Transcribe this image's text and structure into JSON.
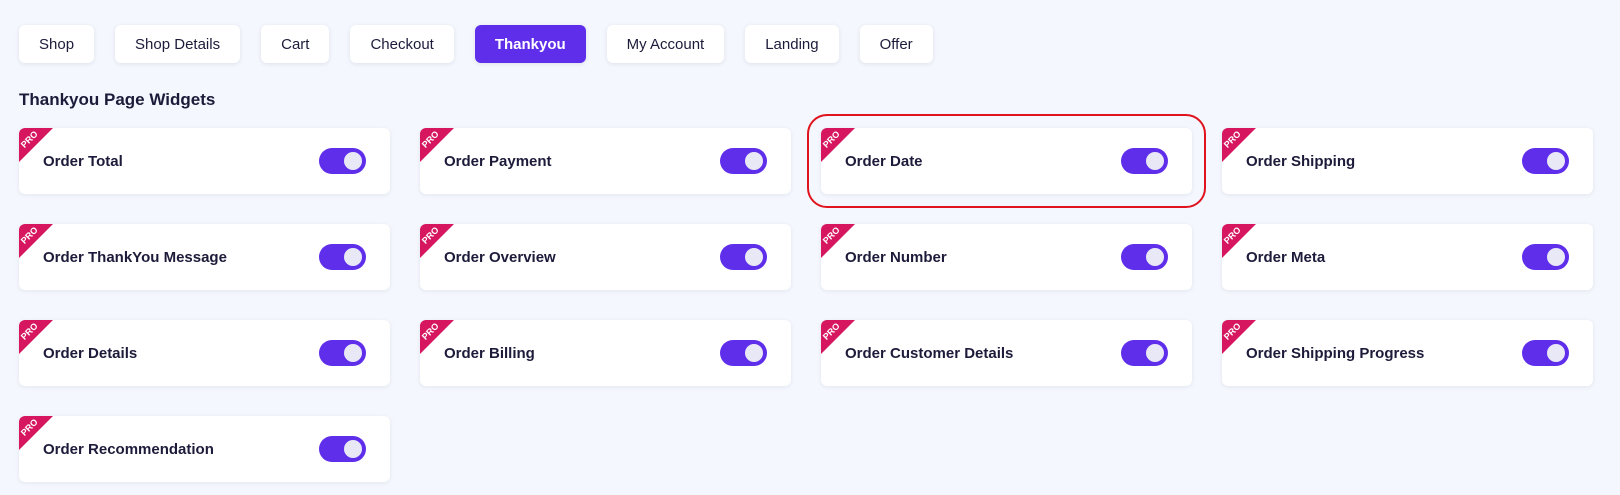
{
  "tabs": [
    {
      "label": "Shop",
      "active": false
    },
    {
      "label": "Shop Details",
      "active": false
    },
    {
      "label": "Cart",
      "active": false
    },
    {
      "label": "Checkout",
      "active": false
    },
    {
      "label": "Thankyou",
      "active": true
    },
    {
      "label": "My Account",
      "active": false
    },
    {
      "label": "Landing",
      "active": false
    },
    {
      "label": "Offer",
      "active": false
    }
  ],
  "section": {
    "title": "Thankyou Page Widgets"
  },
  "badge_text": "PRO",
  "colors": {
    "accent": "#5f2eea",
    "pro_ribbon": "#d6165f",
    "highlight": "#e0141e"
  },
  "widgets": [
    {
      "label": "Order Total",
      "enabled": true,
      "pro": true
    },
    {
      "label": "Order Payment",
      "enabled": true,
      "pro": true
    },
    {
      "label": "Order Date",
      "enabled": true,
      "pro": true,
      "highlighted": true
    },
    {
      "label": "Order Shipping",
      "enabled": true,
      "pro": true
    },
    {
      "label": "Order ThankYou Message",
      "enabled": true,
      "pro": true
    },
    {
      "label": "Order Overview",
      "enabled": true,
      "pro": true
    },
    {
      "label": "Order Number",
      "enabled": true,
      "pro": true
    },
    {
      "label": "Order Meta",
      "enabled": true,
      "pro": true
    },
    {
      "label": "Order Details",
      "enabled": true,
      "pro": true
    },
    {
      "label": "Order Billing",
      "enabled": true,
      "pro": true
    },
    {
      "label": "Order Customer Details",
      "enabled": true,
      "pro": true
    },
    {
      "label": "Order Shipping Progress",
      "enabled": true,
      "pro": true
    },
    {
      "label": "Order Recommendation",
      "enabled": true,
      "pro": true
    }
  ]
}
